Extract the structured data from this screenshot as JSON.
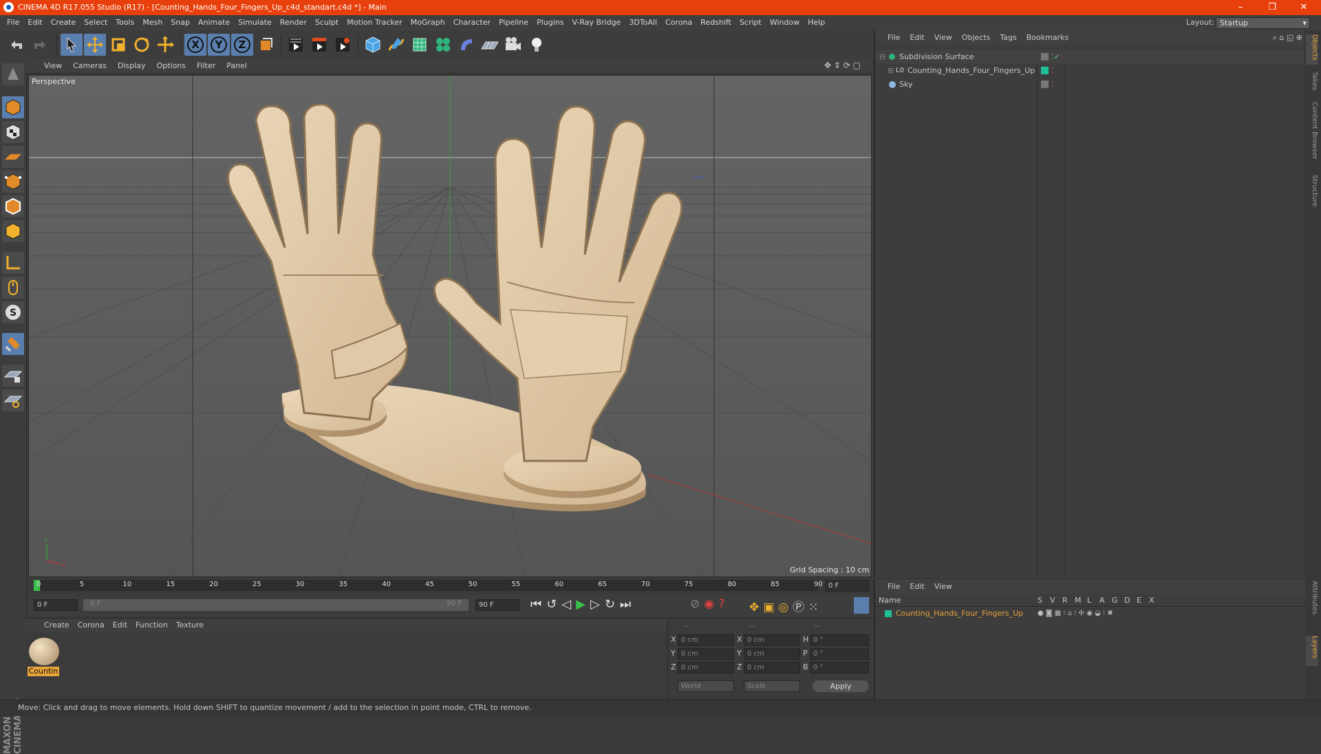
{
  "window": {
    "title": "CINEMA 4D R17.055 Studio (R17) - [Counting_Hands_Four_Fingers_Up_c4d_standart.c4d *] - Main"
  },
  "menu": [
    "File",
    "Edit",
    "Create",
    "Select",
    "Tools",
    "Mesh",
    "Snap",
    "Animate",
    "Simulate",
    "Render",
    "Sculpt",
    "Motion Tracker",
    "MoGraph",
    "Character",
    "Pipeline",
    "Plugins",
    "V-Ray Bridge",
    "3DToAll",
    "Corona",
    "Redshift",
    "Script",
    "Window",
    "Help"
  ],
  "layout": {
    "label": "Layout:",
    "value": "Startup"
  },
  "viewport": {
    "menu": [
      "View",
      "Cameras",
      "Display",
      "Options",
      "Filter",
      "Panel"
    ],
    "name": "Perspective",
    "grid_spacing": "Grid Spacing : 10 cm"
  },
  "object_manager": {
    "menu": [
      "File",
      "Edit",
      "View",
      "Objects",
      "Tags",
      "Bookmarks"
    ],
    "objects": [
      {
        "name": "Subdivision Surface",
        "icon": "subdivision-icon"
      },
      {
        "name": "Counting_Hands_Four_Fingers_Up",
        "icon": "null-icon"
      },
      {
        "name": "Sky",
        "icon": "sky-icon"
      }
    ],
    "side_tabs": [
      "Objects",
      "Takes",
      "Content Browser",
      "Structure"
    ]
  },
  "layer_manager": {
    "menu": [
      "File",
      "Edit",
      "View"
    ],
    "columns": [
      "Name",
      "S",
      "V",
      "R",
      "M",
      "L",
      "A",
      "G",
      "D",
      "E",
      "X"
    ],
    "layers": [
      "Counting_Hands_Four_Fingers_Up"
    ],
    "side_tabs": [
      "Attributes",
      "Layers"
    ]
  },
  "timeline": {
    "ticks": [
      "0",
      "5",
      "10",
      "15",
      "20",
      "25",
      "30",
      "35",
      "40",
      "45",
      "50",
      "55",
      "60",
      "65",
      "70",
      "75",
      "80",
      "85",
      "90"
    ],
    "current_frame": "0 F",
    "start_field": "0 F",
    "range_start": "0 F",
    "range_end": "90 F",
    "end_field": "90 F"
  },
  "material_manager": {
    "menu": [
      "Create",
      "Corona",
      "Edit",
      "Function",
      "Texture"
    ],
    "material_name": "Countin"
  },
  "coordinates": {
    "headers": [
      "--",
      "--",
      "--"
    ],
    "rows": [
      {
        "a": "X",
        "av": "0 cm",
        "b": "X",
        "bv": "0 cm",
        "c": "H",
        "cv": "0 °"
      },
      {
        "a": "Y",
        "av": "0 cm",
        "b": "Y",
        "bv": "0 cm",
        "c": "P",
        "cv": "0 °"
      },
      {
        "a": "Z",
        "av": "0 cm",
        "b": "Z",
        "bv": "0 cm",
        "c": "B",
        "cv": "0 °"
      }
    ],
    "mode": "World",
    "mode2": "Scale",
    "apply": "Apply"
  },
  "status": "Move: Click and drag to move elements. Hold down SHIFT to quantize movement / add to the selection in point mode, CTRL to remove.",
  "brand": "MAXON CINEMA 4D",
  "colors": {
    "titlebar": "#e8400c",
    "accent": "#5a7fae",
    "highlight": "#e8a33a"
  }
}
